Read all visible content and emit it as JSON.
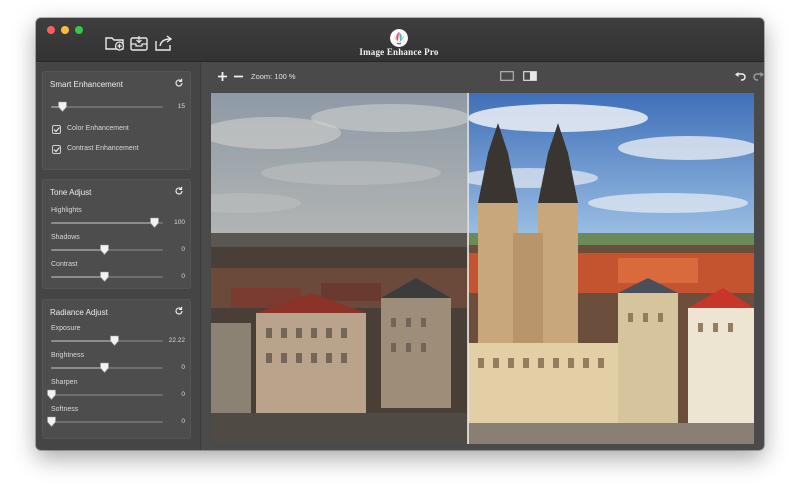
{
  "app": {
    "title": "Image Enhance Pro"
  },
  "toolbar": {
    "zoom_label": "Zoom: 100 %"
  },
  "icons": {
    "add_folder": "folder-plus-icon",
    "import": "tray-import-icon",
    "export": "share-export-icon",
    "zoom_in": "plus-icon",
    "zoom_out": "minus-icon",
    "single_view": "single-view-icon",
    "split_view": "split-view-icon",
    "undo": "undo-icon",
    "redo": "redo-icon",
    "reset": "reset-icon"
  },
  "colors": {
    "window_bg": "#4a4a4a",
    "panel_bg": "#4d4d4d",
    "traffic_close": "#fc605c",
    "traffic_min": "#fdbc40",
    "traffic_max": "#34c84a"
  },
  "smart": {
    "title": "Smart Enhancement",
    "level_value": "15",
    "level_fraction": 0.1,
    "color_label": "Color Enhancement",
    "contrast_label": "Contrast Enhancement",
    "color_checked": true,
    "contrast_checked": true
  },
  "tone": {
    "title": "Tone Adjust",
    "sliders": [
      {
        "label": "Highlights",
        "value": "100",
        "fraction": 0.92
      },
      {
        "label": "Shadows",
        "value": "0",
        "fraction": 0.47
      },
      {
        "label": "Contrast",
        "value": "0",
        "fraction": 0.47
      }
    ]
  },
  "radiance": {
    "title": "Radiance Adjust",
    "sliders": [
      {
        "label": "Exposure",
        "value": "22.22",
        "fraction": 0.56
      },
      {
        "label": "Brightness",
        "value": "0",
        "fraction": 0.47
      },
      {
        "label": "Sharpen",
        "value": "0",
        "fraction": 0.0
      },
      {
        "label": "Softness",
        "value": "0",
        "fraction": 0.0
      }
    ]
  },
  "compare": {
    "split_fraction": 0.47
  }
}
